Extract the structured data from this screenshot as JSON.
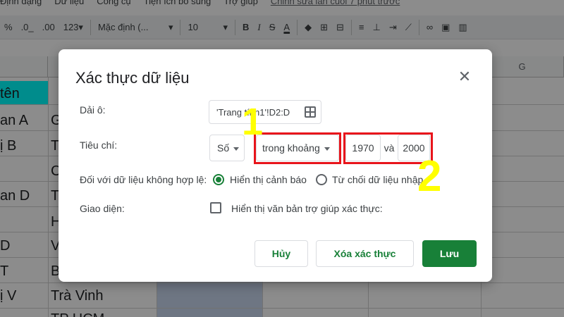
{
  "menubar": {
    "items": [
      "Định dạng",
      "Dữ liệu",
      "Công cụ",
      "Tiện ích bổ sung",
      "Trợ giúp"
    ],
    "last_edit": "Chỉnh sửa lần cuối 7 phút trước"
  },
  "toolbar": {
    "percent": "%",
    "dec_decrease": ".0_",
    "dec_increase": ".00",
    "format_more": "123▾",
    "font": "Mặc định (...",
    "font_size": "10",
    "bold": "B",
    "italic": "I",
    "strike": "S",
    "text_color": "A"
  },
  "sheet": {
    "col_g": "G",
    "header_a": "tên",
    "col_a": [
      "an A",
      "ị B",
      "",
      "an D",
      "",
      "D",
      "T",
      "ị V",
      ""
    ],
    "col_b": [
      "G",
      "T",
      "C",
      "T",
      "H",
      "V",
      "B",
      "Trà Vinh",
      "TP HCM"
    ]
  },
  "dialog": {
    "title": "Xác thực dữ liệu",
    "range_label": "Dải ô:",
    "range_value": "'Trang tính1'!D2:D",
    "criteria_label": "Tiêu chí:",
    "criteria_type": "Số",
    "criteria_condition": "trong khoảng",
    "value_min": "1970",
    "value_and": "và",
    "value_max": "2000",
    "invalid_label": "Đối với dữ liệu không hợp lệ:",
    "option_warning": "Hiển thị cảnh báo",
    "option_reject": "Từ chối dữ liệu nhập",
    "appearance_label": "Giao diện:",
    "help_text_label": "Hiển thị văn bản trợ giúp xác thực:",
    "cancel": "Hủy",
    "remove": "Xóa xác thực",
    "save": "Lưu"
  },
  "annotations": {
    "marker_1": "1",
    "marker_2": "2"
  },
  "colors": {
    "accent_green": "#188038",
    "annotation_red": "#e8141b",
    "annotation_yellow": "#ffff00"
  }
}
